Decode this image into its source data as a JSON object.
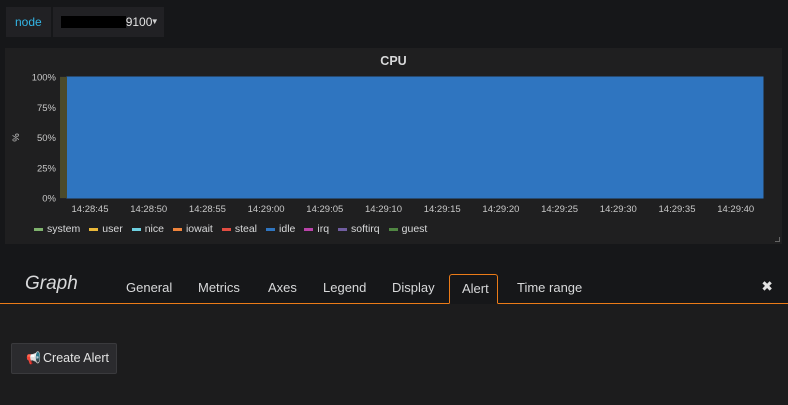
{
  "variables": {
    "label": "node",
    "value": "9100",
    "caret_icon": "caret-down"
  },
  "panel": {
    "title": "CPU",
    "resize_icon": "resize-handle"
  },
  "chart_data": {
    "type": "area",
    "title": "CPU",
    "ylabel": "%",
    "ylim": [
      0,
      100
    ],
    "yticks": [
      "0%",
      "25%",
      "50%",
      "75%",
      "100%"
    ],
    "x": [
      "14:28:45",
      "14:28:50",
      "14:28:55",
      "14:29:00",
      "14:29:05",
      "14:29:10",
      "14:29:15",
      "14:29:20",
      "14:29:25",
      "14:29:30",
      "14:29:35",
      "14:29:40"
    ],
    "stacked": true,
    "series": [
      {
        "name": "system",
        "color": "#7eb26d",
        "values": [
          0,
          0,
          0,
          0,
          0,
          0,
          0,
          0,
          0,
          0,
          0,
          0
        ]
      },
      {
        "name": "user",
        "color": "#eab839",
        "values": [
          0,
          0,
          0,
          0,
          0,
          0,
          0,
          0,
          0,
          0,
          0,
          0
        ]
      },
      {
        "name": "nice",
        "color": "#6ed0e0",
        "values": [
          0,
          0,
          0,
          0,
          0,
          0,
          0,
          0,
          0,
          0,
          0,
          0
        ]
      },
      {
        "name": "iowait",
        "color": "#ef843c",
        "values": [
          0,
          0,
          0,
          0,
          0,
          0,
          0,
          0,
          0,
          0,
          0,
          0
        ]
      },
      {
        "name": "steal",
        "color": "#e24d42",
        "values": [
          0,
          0,
          0,
          0,
          0,
          0,
          0,
          0,
          0,
          0,
          0,
          0
        ]
      },
      {
        "name": "idle",
        "color": "#2f75c0",
        "values": [
          100,
          100,
          100,
          100,
          100,
          100,
          100,
          100,
          100,
          100,
          100,
          100
        ]
      },
      {
        "name": "irq",
        "color": "#ba43a9",
        "values": [
          0,
          0,
          0,
          0,
          0,
          0,
          0,
          0,
          0,
          0,
          0,
          0
        ]
      },
      {
        "name": "softirq",
        "color": "#705da0",
        "values": [
          0,
          0,
          0,
          0,
          0,
          0,
          0,
          0,
          0,
          0,
          0,
          0
        ]
      },
      {
        "name": "guest",
        "color": "#508642",
        "values": [
          0,
          0,
          0,
          0,
          0,
          0,
          0,
          0,
          0,
          0,
          0,
          0
        ]
      }
    ],
    "legend_position": "bottom"
  },
  "editor": {
    "title": "Graph",
    "tabs": [
      {
        "label": "General",
        "active": false
      },
      {
        "label": "Metrics",
        "active": false
      },
      {
        "label": "Axes",
        "active": false
      },
      {
        "label": "Legend",
        "active": false
      },
      {
        "label": "Display",
        "active": false
      },
      {
        "label": "Alert",
        "active": true
      },
      {
        "label": "Time range",
        "active": false
      }
    ],
    "close_icon": "close-icon",
    "accent_color": "#eb7b18"
  },
  "alert": {
    "create_button_label": "Create Alert",
    "create_button_icon": "bullhorn-icon"
  }
}
